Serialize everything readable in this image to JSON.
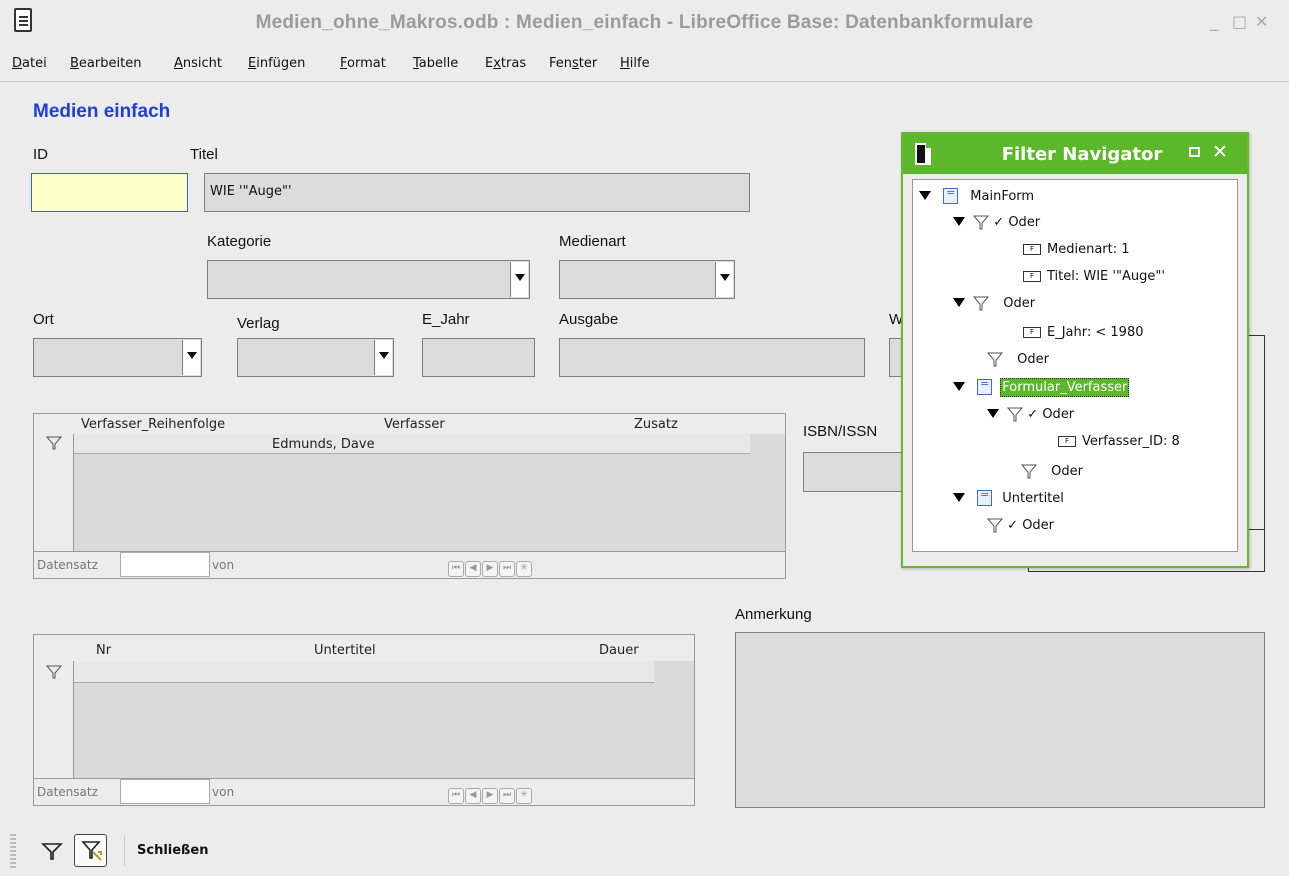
{
  "window": {
    "title": "Medien_ohne_Makros.odb : Medien_einfach - LibreOffice Base: Datenbankformulare",
    "minimize": "_",
    "maximize": "□",
    "close": "✕"
  },
  "menu": [
    {
      "pre": "",
      "u": "D",
      "post": "atei"
    },
    {
      "pre": "",
      "u": "B",
      "post": "earbeiten"
    },
    {
      "pre": "",
      "u": "A",
      "post": "nsicht"
    },
    {
      "pre": "",
      "u": "E",
      "post": "infügen"
    },
    {
      "pre": "",
      "u": "F",
      "post": "ormat"
    },
    {
      "pre": "",
      "u": "T",
      "post": "abelle"
    },
    {
      "pre": "E",
      "u": "x",
      "post": "tras"
    },
    {
      "pre": "Fen",
      "u": "s",
      "post": "ter"
    },
    {
      "pre": "",
      "u": "H",
      "post": "ilfe"
    }
  ],
  "form": {
    "title": "Medien einfach",
    "labels": {
      "id": "ID",
      "titel": "Titel",
      "kategorie": "Kategorie",
      "medienart": "Medienart",
      "ort": "Ort",
      "verlag": "Verlag",
      "e_jahr": "E_Jahr",
      "ausgabe": "Ausgabe",
      "w_partial": "W",
      "isbn": "ISBN/ISSN",
      "anmerkung": "Anmerkung"
    },
    "values": {
      "id": "",
      "titel": "WIE '\"Auge\"'"
    }
  },
  "verfasser_grid": {
    "columns": [
      "Verfasser_Reihenfolge",
      "Verfasser",
      "Zusatz"
    ],
    "rows": [
      [
        "",
        "Edmunds, Dave",
        ""
      ]
    ],
    "nav_label": "Datensatz",
    "nav_von": "von"
  },
  "untertitel_grid": {
    "columns": [
      "Nr",
      "Untertitel",
      "Dauer"
    ],
    "rows": [
      [
        "",
        "",
        ""
      ]
    ],
    "nav_label": "Datensatz",
    "nav_von": "von"
  },
  "filter_navigator": {
    "title": "Filter Navigator",
    "tree": {
      "mainform": "MainForm",
      "oder1": "Oder",
      "cond_medienart": "Medienart:  1",
      "cond_titel": "Titel:  WIE '\"Auge\"'",
      "oder2": "Oder",
      "cond_ejahr": "E_Jahr:  < 1980",
      "oder3": "Oder",
      "formular_verfasser": "Formular_Verfasser",
      "oder4": "Oder",
      "cond_verfasser_id": "Verfasser_ID:  8",
      "oder5": "Oder",
      "untertitel": "Untertitel",
      "oder6": "Oder"
    },
    "accent_color": "#5cb82a"
  },
  "toolbar": {
    "close_label": "Schließen"
  },
  "colors": {
    "title_blue": "#1f3fd8",
    "id_field": "#fefec8",
    "selection_green": "#5cb82a"
  }
}
